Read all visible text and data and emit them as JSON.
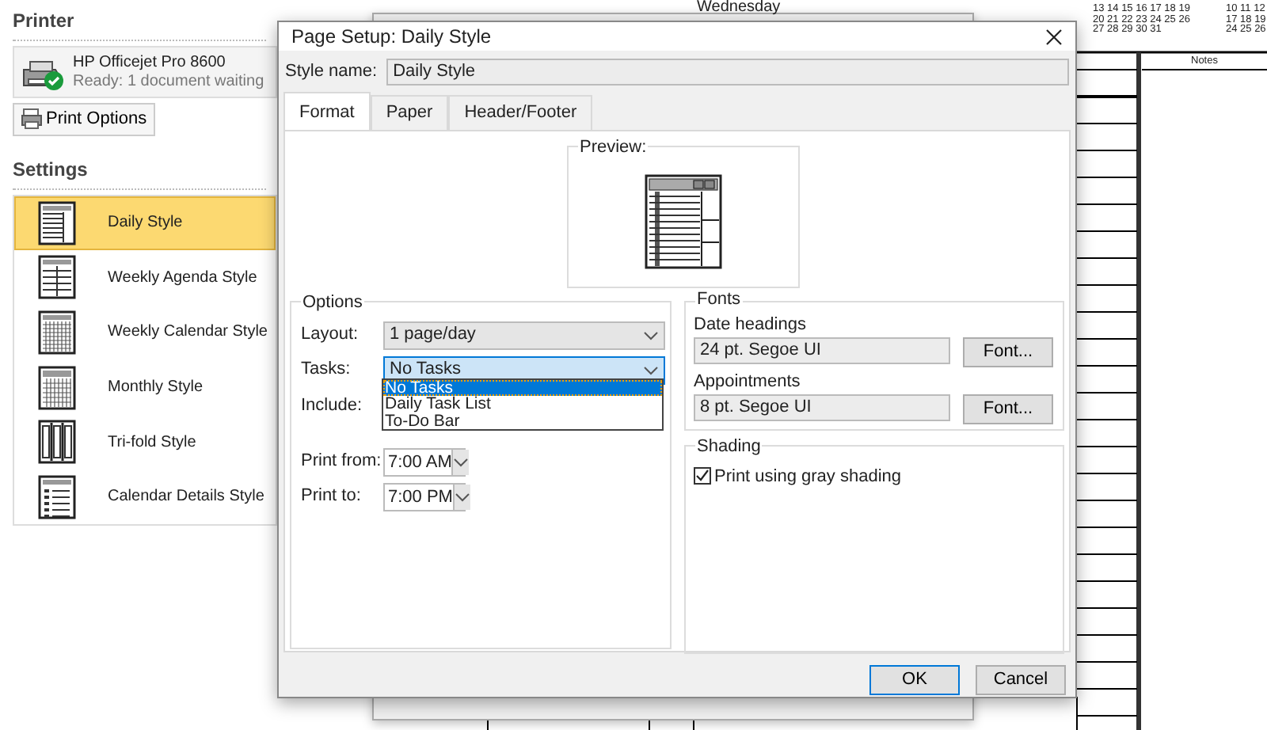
{
  "backstage": {
    "printer_heading": "Printer",
    "printer": {
      "name": "HP Officejet Pro 8600",
      "status": "Ready: 1 document waiting"
    },
    "options_button": "Print Options",
    "settings_heading": "Settings",
    "styles": [
      {
        "label": "Daily Style",
        "kind": "daily",
        "selected": true
      },
      {
        "label": "Weekly Agenda Style",
        "kind": "agenda",
        "selected": false
      },
      {
        "label": "Weekly Calendar Style",
        "kind": "calendar",
        "selected": false
      },
      {
        "label": "Monthly Style",
        "kind": "monthly",
        "selected": false
      },
      {
        "label": "Tri-fold Style",
        "kind": "trifold",
        "selected": false
      },
      {
        "label": "Calendar Details Style",
        "kind": "details",
        "selected": false
      }
    ]
  },
  "preview_page": {
    "day_heading": "Wednesday",
    "notes_heading": "Notes",
    "mini_calendars": [
      {
        "rows": [
          "13 14 15 16 17 18 19",
          "20 21 22 23 24 25 26",
          "27 28 29 30 31"
        ]
      },
      {
        "rows": [
          "10 11 12",
          "17 18 19",
          "24 25 26"
        ]
      }
    ]
  },
  "dialog": {
    "title": "Page Setup: Daily Style",
    "style_name_label": "Style name:",
    "style_name": "Daily Style",
    "tabs": [
      {
        "label": "Format",
        "selected": true
      },
      {
        "label": "Paper",
        "selected": false
      },
      {
        "label": "Header/Footer",
        "selected": false
      }
    ],
    "preview_label": "Preview:",
    "options": {
      "title": "Options",
      "layout": {
        "label": "Layout:",
        "value": "1 page/day"
      },
      "tasks": {
        "label": "Tasks:",
        "value": "No Tasks",
        "expanded": true,
        "items": [
          {
            "label": "No Tasks",
            "selected": true
          },
          {
            "label": "Daily Task List",
            "selected": false
          },
          {
            "label": "To-Do Bar",
            "selected": false
          }
        ]
      },
      "include_label": "Include:",
      "print_from": {
        "label": "Print from:",
        "value": "7:00 AM"
      },
      "print_to": {
        "label": "Print to:",
        "value": "7:00 PM"
      }
    },
    "fonts": {
      "title": "Fonts",
      "groups": [
        {
          "label": "Date headings",
          "value": "24 pt. Segoe UI",
          "button": "Font..."
        },
        {
          "label": "Appointments",
          "value": "8 pt. Segoe UI",
          "button": "Font..."
        }
      ]
    },
    "shading": {
      "title": "Shading",
      "checkbox": {
        "label": "Print using gray shading",
        "checked": true
      }
    },
    "buttons": [
      {
        "label": "OK",
        "default": true
      },
      {
        "label": "Cancel",
        "default": false
      }
    ]
  }
}
